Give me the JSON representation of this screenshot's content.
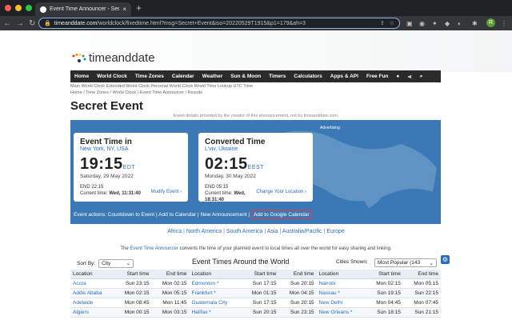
{
  "browser": {
    "tab_title": "Event Time Announcer - Secre",
    "tab_close": "×",
    "new_tab": "+",
    "url_host": "timeanddate.com",
    "url_path": "/worldclock/fixedtime.html?msg=Secret+Event&iso=20220529T1915&p1=179&ah=3",
    "avatar_letter": "R"
  },
  "site": {
    "logo_text": "timeanddate",
    "nav": [
      "Home",
      "World Clock",
      "Time Zones",
      "Calendar",
      "Weather",
      "Sun & Moon",
      "Timers",
      "Calculators",
      "Apps & API",
      "Free Fun"
    ],
    "breadcrumb_1": "Main World Clock   Extended World Clock   Personal World Clock   World Time Lookup   UTC Time",
    "breadcrumb_2": "Home /   Time Zones /   World Clock /   Event Time Announcer /   Results",
    "page_title": "Secret Event",
    "subnote": "Event details provided by the creator of this announcement, not by timeanddate.com.",
    "advertising": "Advertising"
  },
  "event_card": {
    "heading": "Event Time in",
    "location": "New York, NY, USA",
    "time": "19:15",
    "tz": "EDT",
    "date": "Saturday, 29 May 2022",
    "end": "END 22:15",
    "current_label": "Current time:",
    "current_value": "Wed, 11:31:40",
    "modify": "Modify Event ›"
  },
  "converted_card": {
    "heading": "Converted Time",
    "location": "L'viv, Ukraine",
    "time": "02:15",
    "tz": "EEST",
    "date": "Monday, 30 May 2022",
    "end": "END 05:15",
    "current_label": "Current time:",
    "current_value_1": "Wed,",
    "current_value_2": "18:31:40",
    "change": "Change Your Location ›"
  },
  "actions": {
    "label": "Event actions:",
    "countdown": "Countdown to Event",
    "calendar": "Add to Calendar",
    "announce": "New Announcement",
    "google": "Add to Google Calendar"
  },
  "regions": [
    "Africa",
    "North America",
    "South America",
    "Asia",
    "Australia/Pacific",
    "Europe"
  ],
  "intro": {
    "pre": "The",
    "link": "Event Time Announcer",
    "post": "converts the time of your planned event to local times all over the world for easy sharing and linking."
  },
  "table_controls": {
    "sort_label": "Sort By:",
    "sort_value": "City",
    "title": "Event Times Around the World",
    "cities_label": "Cities Shown:",
    "cities_value": "Most Popular (143",
    "gear": "⚙"
  },
  "table": {
    "headers": [
      "Location",
      "Start time",
      "End time",
      "Location",
      "Start time",
      "End time",
      "Location",
      "Start time",
      "End time"
    ],
    "rows": [
      [
        "Accra",
        "Sun 23:15",
        "Mon 02:15",
        "Edmonton *",
        "Sun 17:15",
        "Sun 20:15",
        "Nairobi",
        "Mon 02:15",
        "Mon 05:15"
      ],
      [
        "Addis Ababa",
        "Mon 02:15",
        "Mon 05:15",
        "Frankfurt *",
        "Mon 01:15",
        "Mon 04:15",
        "Nassau *",
        "Sun 19:15",
        "Sun 22:15"
      ],
      [
        "Adelaide",
        "Mon 08:45",
        "Mon 11:45",
        "Guatemala City",
        "Sun 17:15",
        "Sun 20:15",
        "New Delhi",
        "Mon 04:45",
        "Mon 07:45"
      ],
      [
        "Algiers",
        "Mon 00:15",
        "Mon 03:15",
        "Halifax *",
        "Sun 20:15",
        "Sun 23:15",
        "New Orleans *",
        "Sun 18:15",
        "Sun 21:15"
      ]
    ]
  }
}
